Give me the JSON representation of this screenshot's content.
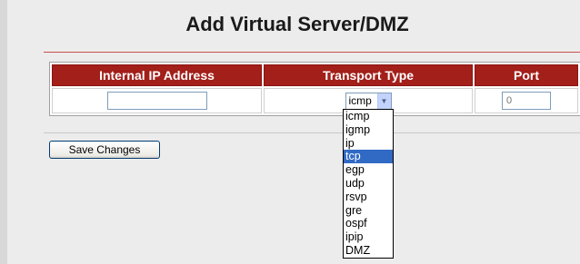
{
  "page": {
    "title": "Add Virtual Server/DMZ"
  },
  "table": {
    "headers": [
      "Internal IP Address",
      "Transport Type",
      "Port"
    ],
    "row": {
      "ip_value": "",
      "transport_selected": "icmp",
      "port_placeholder": "0"
    }
  },
  "dropdown": {
    "options": [
      "icmp",
      "igmp",
      "ip",
      "tcp",
      "egp",
      "udp",
      "rsvp",
      "gre",
      "ospf",
      "ipip",
      "DMZ"
    ],
    "highlighted": "tcp"
  },
  "actions": {
    "save_label": "Save Changes"
  },
  "icons": {
    "dropdown_arrow": "chevron-down-icon"
  },
  "colors": {
    "header_bg": "#a31f1a",
    "highlight": "#316ac5",
    "divider": "#c8504a"
  }
}
